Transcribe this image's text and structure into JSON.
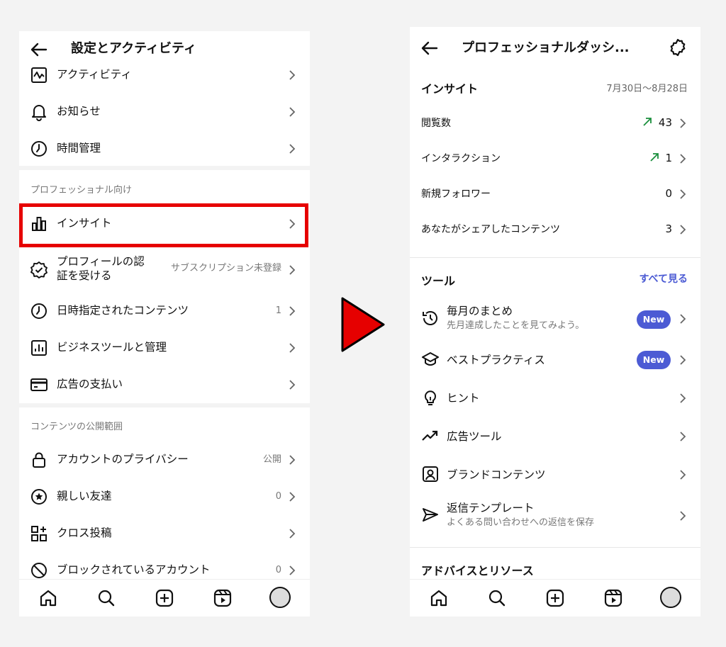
{
  "left": {
    "title": "設定とアクティビティ",
    "rows_top": [
      {
        "label": "アクティビティ",
        "icon": "activity-chart-icon"
      },
      {
        "label": "お知らせ",
        "icon": "bell-icon"
      },
      {
        "label": "時間管理",
        "icon": "clock-icon"
      }
    ],
    "section_professional": "プロフェッショナル向け",
    "insight_label": "インサイト",
    "verify_label_line1": "プロフィールの認",
    "verify_label_line2": "証を受ける",
    "verify_value": "サブスクリプション未登録",
    "scheduled_label": "日時指定されたコンテンツ",
    "scheduled_value": "1",
    "business_label": "ビジネスツールと管理",
    "ads_payment_label": "広告の支払い",
    "section_visibility": "コンテンツの公開範囲",
    "privacy_label": "アカウントのプライバシー",
    "privacy_value": "公開",
    "close_friends_label": "親しい友達",
    "close_friends_value": "0",
    "crosspost_label": "クロス投稿",
    "blocked_label": "ブロックされているアカウント",
    "blocked_value": "0"
  },
  "right": {
    "title": "プロフェッショナルダッシ...",
    "insights_heading": "インサイト",
    "date_range": "7月30日〜8月28日",
    "metrics": [
      {
        "label": "閲覧数",
        "value": "43",
        "trend": "up"
      },
      {
        "label": "インタラクション",
        "value": "1",
        "trend": "up"
      },
      {
        "label": "新規フォロワー",
        "value": "0",
        "trend": ""
      },
      {
        "label": "あなたがシェアしたコンテンツ",
        "value": "3",
        "trend": ""
      }
    ],
    "tools_heading": "ツール",
    "see_all": "すべて見る",
    "tools": [
      {
        "title": "毎月のまとめ",
        "subtitle": "先月達成したことを見てみよう。",
        "badge": "New"
      },
      {
        "title": "ベストプラクティス",
        "badge": "New"
      },
      {
        "title": "ヒント"
      },
      {
        "title": "広告ツール"
      },
      {
        "title": "ブランドコンテンツ"
      },
      {
        "title": "返信テンプレート",
        "subtitle": "よくある問い合わせへの返信を保存"
      }
    ],
    "advice_heading": "アドバイスとリソース"
  },
  "colors": {
    "highlight": "#e60000",
    "trend_up": "#1a8f3c",
    "link": "#4c5bd4",
    "badge": "#4c5bd4",
    "arrow": "#e60000"
  }
}
